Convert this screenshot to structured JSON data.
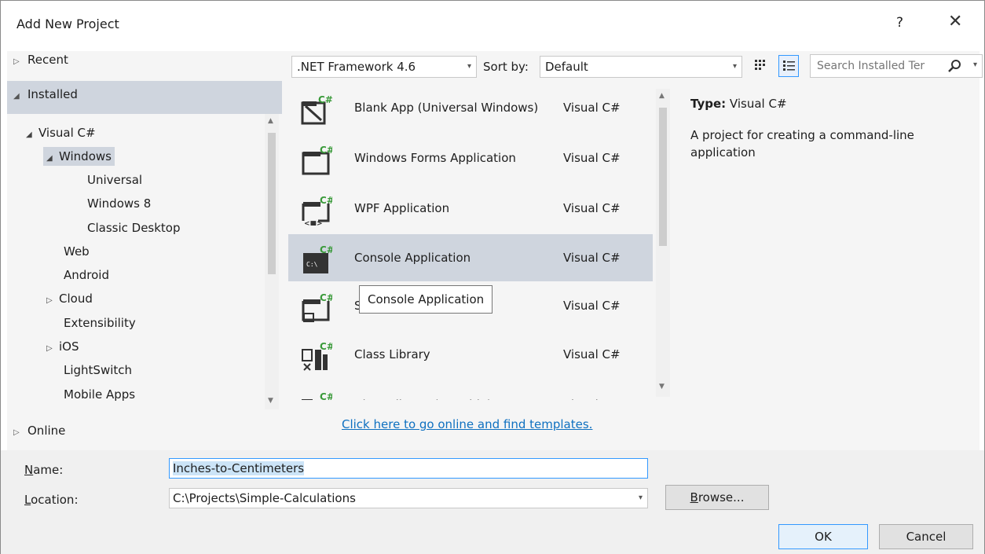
{
  "window": {
    "title": "Add New Project",
    "help_label": "?",
    "close_label": "✕"
  },
  "nav": {
    "recent_label": "Recent",
    "installed_label": "Installed",
    "online_label": "Online",
    "tree": [
      {
        "label": "Visual C#",
        "expanded": true
      },
      {
        "label": "Windows",
        "expanded": true,
        "selected": true
      },
      {
        "label": "Universal"
      },
      {
        "label": "Windows 8"
      },
      {
        "label": "Classic Desktop"
      },
      {
        "label": "Web"
      },
      {
        "label": "Android"
      },
      {
        "label": "Cloud",
        "expanded": false
      },
      {
        "label": "Extensibility"
      },
      {
        "label": "iOS",
        "expanded": false
      },
      {
        "label": "LightSwitch"
      },
      {
        "label": "Mobile Apps"
      }
    ]
  },
  "toolbar": {
    "framework_value": ".NET Framework 4.6",
    "sort_label": "Sort by:",
    "sort_value": "Default",
    "search_placeholder": "Search Installed Ter"
  },
  "templates": [
    {
      "name": "Blank App (Universal Windows)",
      "lang": "Visual C#"
    },
    {
      "name": "Windows Forms Application",
      "lang": "Visual C#"
    },
    {
      "name": "WPF Application",
      "lang": "Visual C#"
    },
    {
      "name": "Console Application",
      "lang": "Visual C#",
      "selected": true
    },
    {
      "name": "S",
      "lang": "Visual C#"
    },
    {
      "name": "Class Library",
      "lang": "Visual C#"
    },
    {
      "name": "Class Library (Portable)",
      "lang": "Visual C#"
    }
  ],
  "tooltip": "Console Application",
  "details": {
    "type_label": "Type:",
    "type_value": "Visual C#",
    "description": "A project for creating a command-line application"
  },
  "online_link": "Click here to go online and find templates.",
  "form": {
    "name_label_u": "N",
    "name_label_rest": "ame:",
    "name_value": "Inches-to-Centimeters",
    "location_label_u": "L",
    "location_label_rest": "ocation:",
    "location_value": "C:\\Projects\\Simple-Calculations",
    "browse_u": "B",
    "browse_rest": "rowse...",
    "ok_label": "OK",
    "cancel_label": "Cancel"
  },
  "colors": {
    "selection": "#cfd5de",
    "link": "#0e70c0",
    "focus": "#3399ff",
    "icon_green": "#3a9a3a"
  }
}
